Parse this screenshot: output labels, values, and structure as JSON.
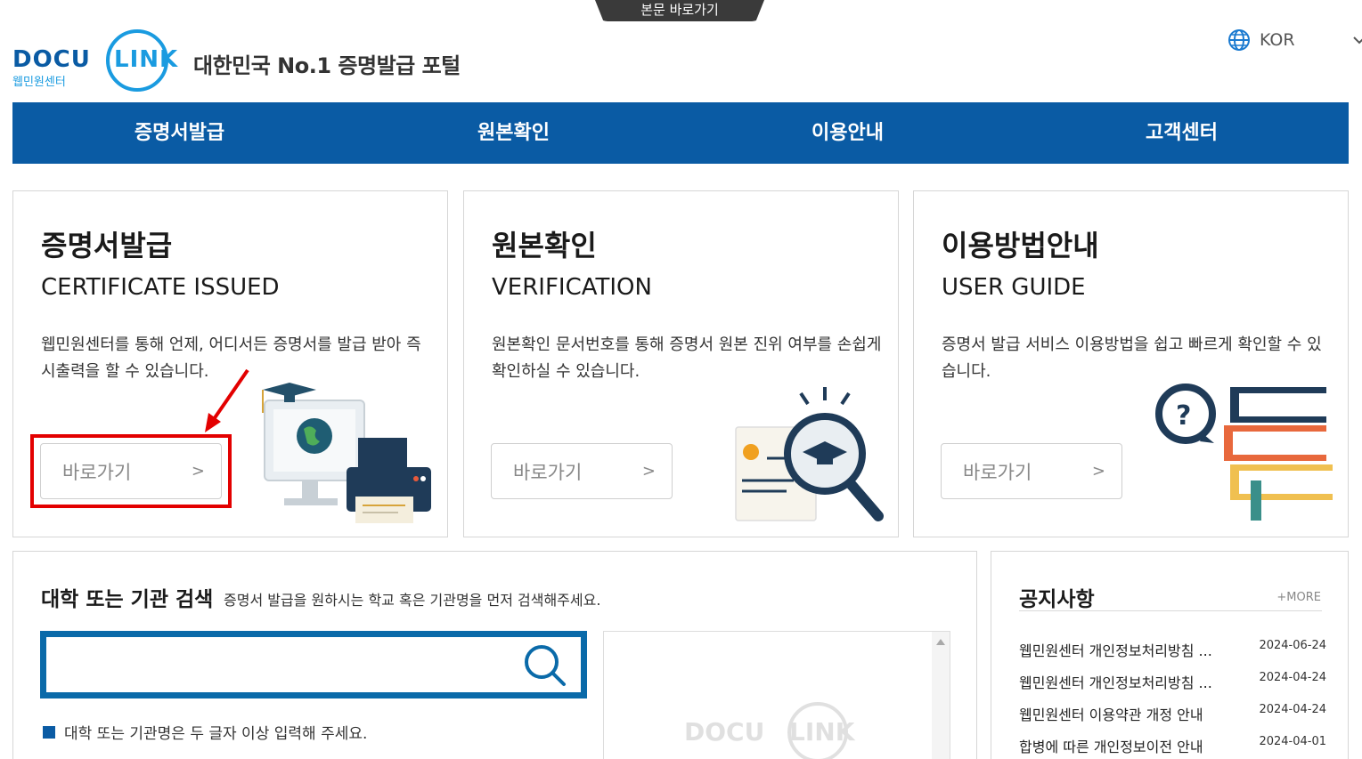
{
  "skip_link": "본문 바로가기",
  "header": {
    "logo_text": "DOCU LINK",
    "logo_sub": "웹민원센터",
    "tagline": "대한민국 No.1 증명발급 포털",
    "language": "KOR"
  },
  "nav": [
    {
      "label": "증명서발급"
    },
    {
      "label": "원본확인"
    },
    {
      "label": "이용안내"
    },
    {
      "label": "고객센터"
    }
  ],
  "cards": [
    {
      "title": "증명서발급",
      "subtitle": "CERTIFICATE ISSUED",
      "desc": "웹민원센터를 통해 언제, 어디서든 증명서를 발급 받아 즉시출력을 할 수 있습니다.",
      "button": "바로가기",
      "button_icon": ">"
    },
    {
      "title": "원본확인",
      "subtitle": "VERIFICATION",
      "desc": "원본확인 문서번호를 통해 증명서 원본 진위 여부를 손쉽게 확인하실 수 있습니다.",
      "button": "바로가기",
      "button_icon": ">"
    },
    {
      "title": "이용방법안내",
      "subtitle": "USER GUIDE",
      "desc": "증명서 발급 서비스 이용방법을 쉽고 빠르게 확인할 수 있습니다.",
      "button": "바로가기",
      "button_icon": ">"
    }
  ],
  "search": {
    "title": "대학 또는 기관 검색",
    "subtitle": "증명서 발급을 원하시는 학교 혹은 기관명을 먼저 검색해주세요.",
    "input_value": "",
    "hint": "대학 또는 기관명은 두 글자 이상 입력해 주세요."
  },
  "notices": {
    "title": "공지사항",
    "more": "+MORE",
    "items": [
      {
        "title": "웹민원센터 개인정보처리방침 ...",
        "date": "2024-06-24"
      },
      {
        "title": "웹민원센터 개인정보처리방침 ...",
        "date": "2024-04-24"
      },
      {
        "title": "웹민원센터 이용약관 개정 안내",
        "date": "2024-04-24"
      },
      {
        "title": "합병에 따른 개인정보이전 안내",
        "date": "2024-04-01"
      }
    ]
  },
  "colors": {
    "primary": "#0a5ba4",
    "highlight": "#e30000",
    "logo_blue": "#1a9be0"
  }
}
